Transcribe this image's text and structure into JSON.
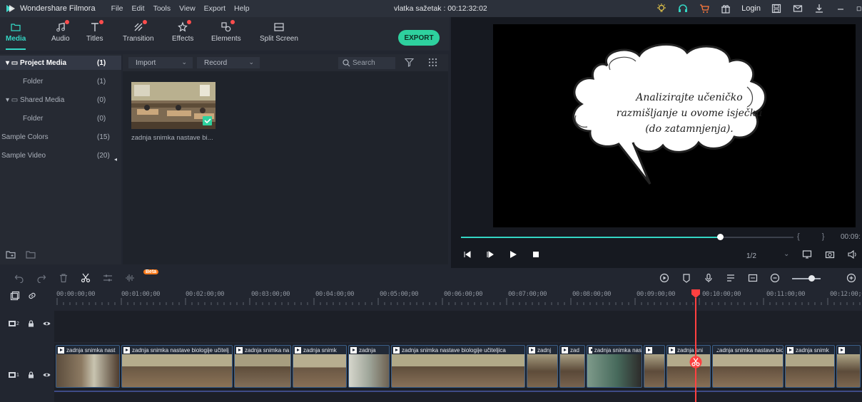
{
  "app": {
    "name": "Wondershare Filmora",
    "project_title": "vlatka sažetak : 00:12:32:02"
  },
  "menu": [
    "File",
    "Edit",
    "Tools",
    "View",
    "Export",
    "Help"
  ],
  "titlebar": {
    "login_label": "Login"
  },
  "media_tabs": [
    {
      "label": "Media",
      "icon": "folder-icon",
      "active": true
    },
    {
      "label": "Audio",
      "icon": "music-note-icon",
      "dot": true
    },
    {
      "label": "Titles",
      "icon": "text-icon",
      "dot": true
    },
    {
      "label": "Transition",
      "icon": "transition-icon",
      "dot": true
    },
    {
      "label": "Effects",
      "icon": "effects-icon",
      "dot": true
    },
    {
      "label": "Elements",
      "icon": "elements-icon",
      "dot": true
    },
    {
      "label": "Split Screen",
      "icon": "split-screen-icon"
    }
  ],
  "export_label": "EXPORT",
  "library": [
    {
      "label": "Project Media",
      "count": "(1)",
      "selected": true
    },
    {
      "label": "Folder",
      "count": "(1)"
    },
    {
      "label": "Shared Media",
      "count": "(0)"
    },
    {
      "label": "Folder",
      "count": "(0)"
    },
    {
      "label": "Sample Colors",
      "count": "(15)"
    },
    {
      "label": "Sample Video",
      "count": "(20)"
    }
  ],
  "media_toolbar": {
    "import_label": "Import",
    "record_label": "Record",
    "search_placeholder": "Search"
  },
  "media_item": {
    "label": "zadnja snimka nastave bi..."
  },
  "preview": {
    "callout_lines": [
      "Analizirajte učeničko",
      "razmišljanje u ovome isječku",
      "(do zatamnjenja)."
    ],
    "progress": 0.78,
    "timecode": "00:09:",
    "brackets": "{ }",
    "ratio": "1/2"
  },
  "ruler_labels": [
    "00:00:00;00",
    "00:01:00;00",
    "00:02:00;00",
    "00:03:00;00",
    "00:04:00;00",
    "00:05:00;00",
    "00:06:00;00",
    "00:07:00;00",
    "00:08:00;00",
    "00:09:00;00",
    "00:10:00;00",
    "00:11:00;00",
    "00:12:00;0"
  ],
  "beta_label": "Beta",
  "track_labels": {
    "track2": "2",
    "track1": "1"
  },
  "clips": [
    "zadnja snimka nast",
    "zadnja snimka nastave biologije učitelj",
    "zadnja snimka na",
    "zadnja snimk",
    "zadnja",
    "zadnja snimka nastave biologije učiteljica",
    "zadnj",
    "zad",
    "zadnja snimka nas",
    "",
    "zadnja sni",
    "zadnja snimka nastave biolo",
    "zadnja snimk",
    ""
  ]
}
